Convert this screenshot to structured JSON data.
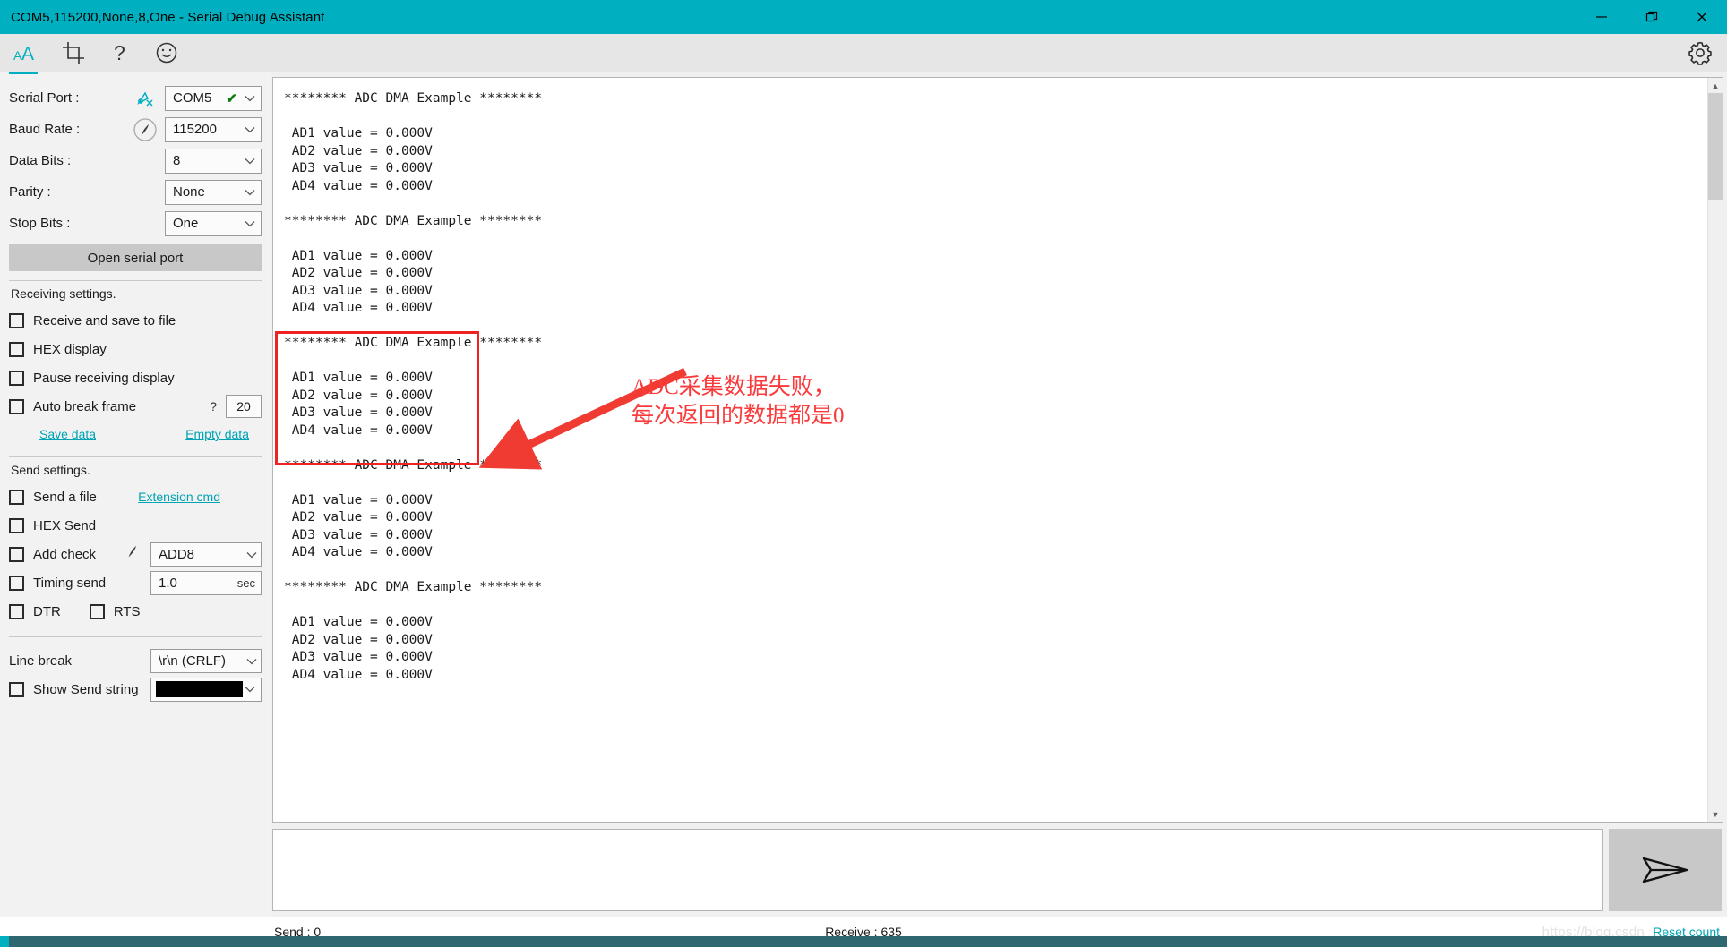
{
  "window": {
    "title": "COM5,115200,None,8,One - Serial Debug Assistant",
    "accent_color": "#00b0c0",
    "minimize_label": "minimize",
    "restore_label": "restore",
    "close_label": "close"
  },
  "toolbar": {
    "items": [
      {
        "name": "font-icon",
        "label": "AA"
      },
      {
        "name": "crop-icon",
        "label": "crop"
      },
      {
        "name": "help-icon",
        "label": "?"
      },
      {
        "name": "smiley-icon",
        "label": "smiley"
      }
    ],
    "settings_label": "gear"
  },
  "sidebar": {
    "serial_port": {
      "label": "Serial Port :",
      "value": "COM5",
      "check": "✔"
    },
    "baud_rate": {
      "label": "Baud Rate :",
      "value": "115200"
    },
    "data_bits": {
      "label": "Data Bits :",
      "value": "8"
    },
    "parity": {
      "label": "Parity :",
      "value": "None"
    },
    "stop_bits": {
      "label": "Stop Bits :",
      "value": "One"
    },
    "open_button": "Open serial port",
    "receiving": {
      "title": "Receiving settings.",
      "receive_save_file": "Receive and save to file",
      "hex_display": "HEX display",
      "pause_display": "Pause receiving display",
      "auto_break_frame": "Auto break frame",
      "auto_break_help": "?",
      "auto_break_value": "20",
      "save_data": "Save data",
      "empty_data": "Empty data"
    },
    "send": {
      "title": "Send settings.",
      "send_a_file": "Send a file",
      "extension_cmd": "Extension cmd",
      "hex_send": "HEX Send",
      "add_check": "Add check",
      "add_check_value": "ADD8",
      "timing_send": "Timing send",
      "timing_value": "1.0",
      "timing_unit": "sec",
      "dtr": "DTR",
      "rts": "RTS"
    },
    "line_break": {
      "label": "Line break",
      "value": "\\r\\n (CRLF)"
    },
    "show_send_string": {
      "label": "Show Send string",
      "color": "#000000"
    }
  },
  "terminal": {
    "text": "******** ADC DMA Example ********\n\n AD1 value = 0.000V\n AD2 value = 0.000V\n AD3 value = 0.000V\n AD4 value = 0.000V\n\n******** ADC DMA Example ********\n\n AD1 value = 0.000V\n AD2 value = 0.000V\n AD3 value = 0.000V\n AD4 value = 0.000V\n\n******** ADC DMA Example ********\n\n AD1 value = 0.000V\n AD2 value = 0.000V\n AD3 value = 0.000V\n AD4 value = 0.000V\n\n******** ADC DMA Example ********\n\n AD1 value = 0.000V\n AD2 value = 0.000V\n AD3 value = 0.000V\n AD4 value = 0.000V\n\n******** ADC DMA Example ********\n\n AD1 value = 0.000V\n AD2 value = 0.000V\n AD3 value = 0.000V\n AD4 value = 0.000V"
  },
  "annotation": {
    "text": "ADC采集数据失败，\n每次返回的数据都是0",
    "color": "#fb3b3b"
  },
  "send_area": {
    "value": "",
    "send_button_label": "send"
  },
  "status": {
    "send": "Send : 0",
    "receive": "Receive : 635",
    "reset": "Reset count",
    "watermark": "https://blog.csdn"
  }
}
